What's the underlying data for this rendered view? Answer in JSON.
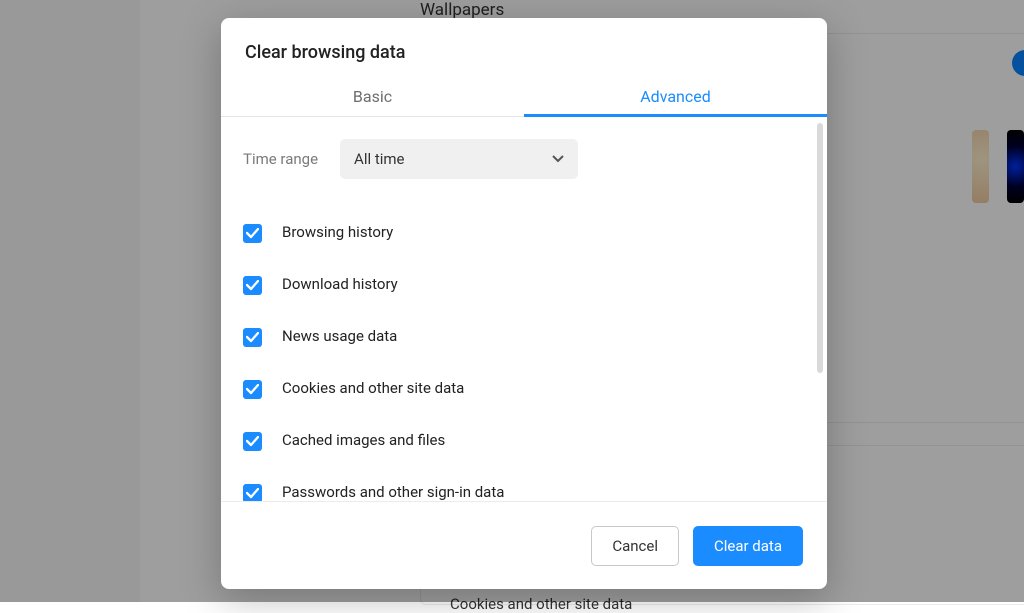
{
  "background": {
    "wallpapers_heading": "Wallpapers",
    "cookies_row_label": "Cookies and other site data"
  },
  "dialog": {
    "title": "Clear browsing data",
    "tabs": {
      "basic": "Basic",
      "advanced": "Advanced",
      "active": "advanced"
    },
    "time_range": {
      "label": "Time range",
      "value": "All time"
    },
    "options": [
      {
        "label": "Browsing history",
        "checked": true
      },
      {
        "label": "Download history",
        "checked": true
      },
      {
        "label": "News usage data",
        "checked": true
      },
      {
        "label": "Cookies and other site data",
        "checked": true
      },
      {
        "label": "Cached images and files",
        "checked": true
      },
      {
        "label": "Passwords and other sign-in data",
        "checked": true
      }
    ],
    "footer": {
      "cancel": "Cancel",
      "confirm": "Clear data"
    }
  },
  "colors": {
    "accent": "#1a8cff"
  }
}
